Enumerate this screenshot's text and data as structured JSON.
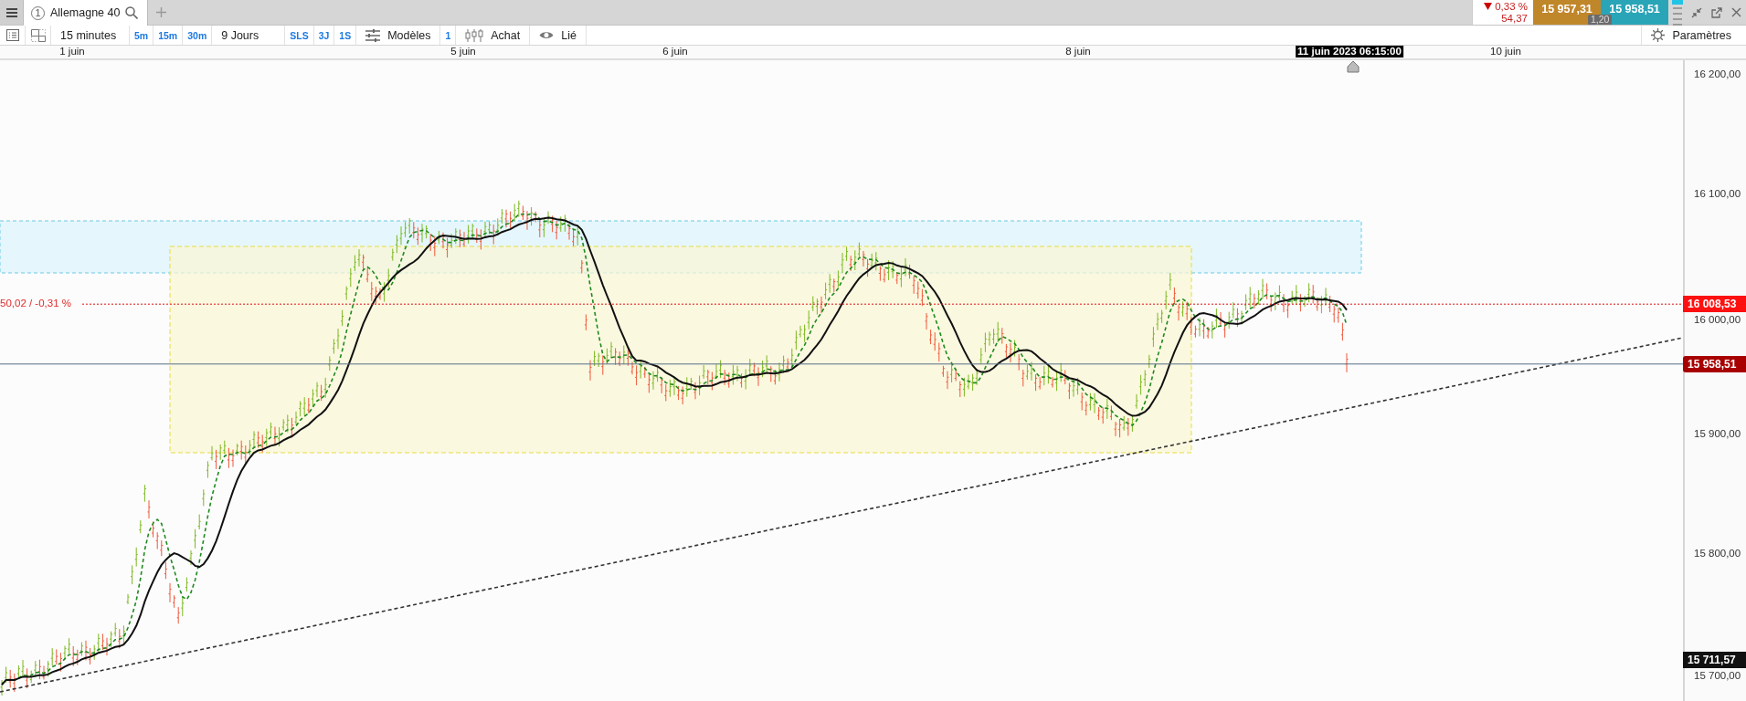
{
  "tabs": [
    {
      "number": "1",
      "label": "Allemagne 40",
      "selected": true
    }
  ],
  "quote": {
    "falling": true,
    "change": "0,33 %",
    "points": "54,37",
    "bid": "15 957,31",
    "ask": "15 958,51",
    "spread": "1,20"
  },
  "toolbar": {
    "interval": "15 minutes",
    "interval_presets": [
      "5m",
      "15m",
      "30m"
    ],
    "period": "9 Jours",
    "period_presets": [
      "SLS",
      "3J",
      "1S"
    ],
    "templates": "Modèles",
    "template_count": "1",
    "order": "Achat",
    "link": "Lié",
    "settings": "Paramètres"
  },
  "time_axis": {
    "labels": [
      "1 juin",
      "5 juin",
      "6 juin",
      "8 juin",
      "10 juin"
    ],
    "cursor": "11 juin 2023 06:15:00"
  },
  "price_axis": {
    "labels": [
      "16 200,00",
      "16 100,00",
      "16 000,00",
      "15 900,00",
      "15 800,00",
      "15 700,00"
    ],
    "tags": [
      {
        "kind": "alert",
        "text": "16 008,53"
      },
      {
        "kind": "last",
        "text": "15 958,51"
      },
      {
        "kind": "low",
        "text": "15 711,57"
      }
    ]
  },
  "alert_line": {
    "label": "50,02 / -0,31 %"
  }
}
